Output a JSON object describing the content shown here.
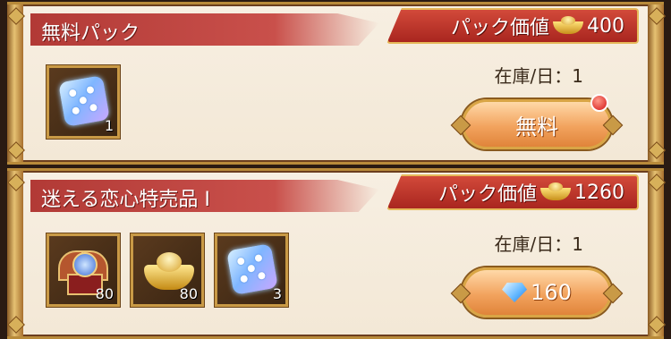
{
  "packs": [
    {
      "title": "無料パック",
      "value_label": "パック価値",
      "value": "400",
      "currency_icon": "gold-ingot-icon",
      "stock": "在庫/日：1",
      "items": [
        {
          "icon": "blue-dice-icon",
          "qty": "1"
        }
      ],
      "button": {
        "label": "無料",
        "type": "free",
        "badge": "red-dot"
      }
    },
    {
      "title": "迷える恋心特売品 I",
      "value_label": "パック価値",
      "value": "1260",
      "currency_icon": "gold-ingot-icon",
      "stock": "在庫/日：1",
      "items": [
        {
          "icon": "crest-emblem-icon",
          "qty": "80"
        },
        {
          "icon": "gold-ingot-icon",
          "qty": "80"
        },
        {
          "icon": "blue-dice-icon",
          "qty": "3"
        }
      ],
      "button": {
        "label": "160",
        "type": "diamond",
        "icon": "diamond-icon"
      }
    }
  ],
  "colors": {
    "title_bar": "#b23a36",
    "value_tag": "#c23a2e",
    "button": "#f2a35e",
    "frame_gold": "#c99a46"
  }
}
